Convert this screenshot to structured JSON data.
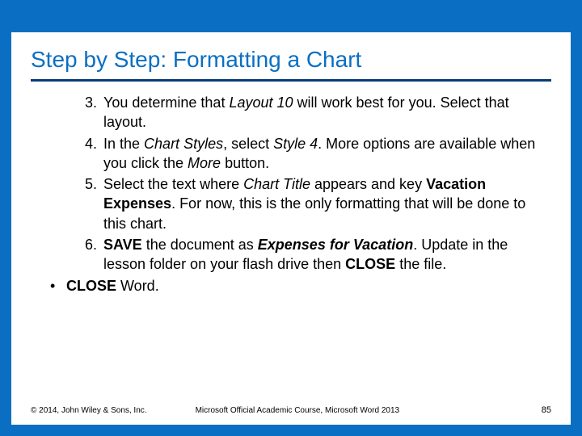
{
  "title": "Step by Step: Formatting a Chart",
  "steps": [
    {
      "num": "3.",
      "segments": [
        {
          "t": "You determine that "
        },
        {
          "t": "Layout 10",
          "cls": "i"
        },
        {
          "t": " will work best for you. Select that layout."
        }
      ]
    },
    {
      "num": "4.",
      "segments": [
        {
          "t": "In the "
        },
        {
          "t": "Chart Styles",
          "cls": "i"
        },
        {
          "t": ", select "
        },
        {
          "t": "Style 4",
          "cls": "i"
        },
        {
          "t": ". More options are available when you click the "
        },
        {
          "t": "More",
          "cls": "i"
        },
        {
          "t": " button."
        }
      ]
    },
    {
      "num": "5.",
      "segments": [
        {
          "t": "Select the text where "
        },
        {
          "t": "Chart Title",
          "cls": "i"
        },
        {
          "t": " appears and key "
        },
        {
          "t": "Vacation Expenses",
          "cls": "b"
        },
        {
          "t": ". For now, this is the only formatting that will be done to this chart."
        }
      ]
    },
    {
      "num": "6.",
      "segments": [
        {
          "t": " "
        },
        {
          "t": "SAVE",
          "cls": "b"
        },
        {
          "t": " the document as "
        },
        {
          "t": "Expenses for Vacation",
          "cls": "bi"
        },
        {
          "t": ". Update in the lesson folder on your flash drive then "
        },
        {
          "t": "CLOSE",
          "cls": "b"
        },
        {
          "t": " the file."
        }
      ]
    }
  ],
  "bullets": [
    {
      "segments": [
        {
          "t": "CLOSE",
          "cls": "b"
        },
        {
          "t": " Word."
        }
      ]
    }
  ],
  "footer": {
    "copyright": "© 2014, John Wiley & Sons, Inc.",
    "course": "Microsoft Official Academic Course, Microsoft Word 2013",
    "page": "85"
  }
}
